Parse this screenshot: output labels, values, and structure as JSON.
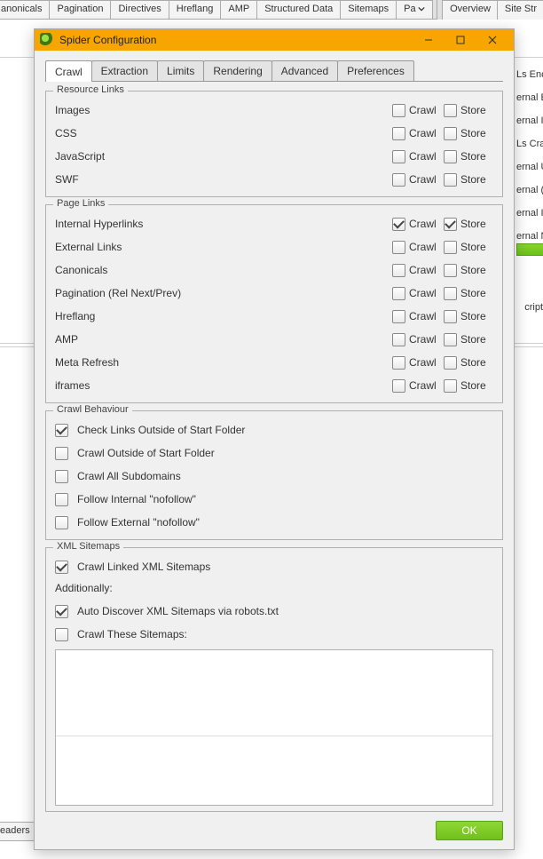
{
  "background": {
    "tabs_left": [
      "anonicals",
      "Pagination",
      "Directives",
      "Hreflang",
      "AMP",
      "Structured Data",
      "Sitemaps",
      "Pa"
    ],
    "tabs_right": [
      "Overview",
      "Site Str"
    ],
    "side_items": [
      "Ls Enc",
      "ernal E",
      "ernal I",
      "Ls Cra",
      "ernal U",
      "ernal (",
      "ernal I",
      "ernal N"
    ],
    "side_finish": "cript",
    "headers_tab": "eaders"
  },
  "dialog": {
    "title": "Spider Configuration",
    "tabs": [
      "Crawl",
      "Extraction",
      "Limits",
      "Rendering",
      "Advanced",
      "Preferences"
    ],
    "active_tab": 0,
    "groups": {
      "resource_links": {
        "legend": "Resource Links",
        "col1": "Crawl",
        "col2": "Store",
        "rows": [
          {
            "label": "Images",
            "crawl": false,
            "store": false
          },
          {
            "label": "CSS",
            "crawl": false,
            "store": false
          },
          {
            "label": "JavaScript",
            "crawl": false,
            "store": false
          },
          {
            "label": "SWF",
            "crawl": false,
            "store": false
          }
        ]
      },
      "page_links": {
        "legend": "Page Links",
        "col1": "Crawl",
        "col2": "Store",
        "rows": [
          {
            "label": "Internal Hyperlinks",
            "crawl": true,
            "store": true
          },
          {
            "label": "External Links",
            "crawl": false,
            "store": false
          },
          {
            "label": "Canonicals",
            "crawl": false,
            "store": false
          },
          {
            "label": "Pagination (Rel Next/Prev)",
            "crawl": false,
            "store": false
          },
          {
            "label": "Hreflang",
            "crawl": false,
            "store": false
          },
          {
            "label": "AMP",
            "crawl": false,
            "store": false
          },
          {
            "label": "Meta Refresh",
            "crawl": false,
            "store": false
          },
          {
            "label": "iframes",
            "crawl": false,
            "store": false
          }
        ]
      },
      "crawl_behaviour": {
        "legend": "Crawl Behaviour",
        "options": [
          {
            "label": "Check Links Outside of Start Folder",
            "checked": true
          },
          {
            "label": "Crawl Outside of Start Folder",
            "checked": false
          },
          {
            "label": "Crawl All Subdomains",
            "checked": false
          },
          {
            "label": "Follow Internal \"nofollow\"",
            "checked": false
          },
          {
            "label": "Follow External \"nofollow\"",
            "checked": false
          }
        ]
      },
      "xml_sitemaps": {
        "legend": "XML Sitemaps",
        "option_top": {
          "label": "Crawl Linked XML Sitemaps",
          "checked": true
        },
        "additionally": "Additionally:",
        "option_auto": {
          "label": "Auto Discover XML Sitemaps via robots.txt",
          "checked": true
        },
        "option_these": {
          "label": "Crawl These Sitemaps:",
          "checked": false
        }
      }
    },
    "ok_label": "OK"
  }
}
